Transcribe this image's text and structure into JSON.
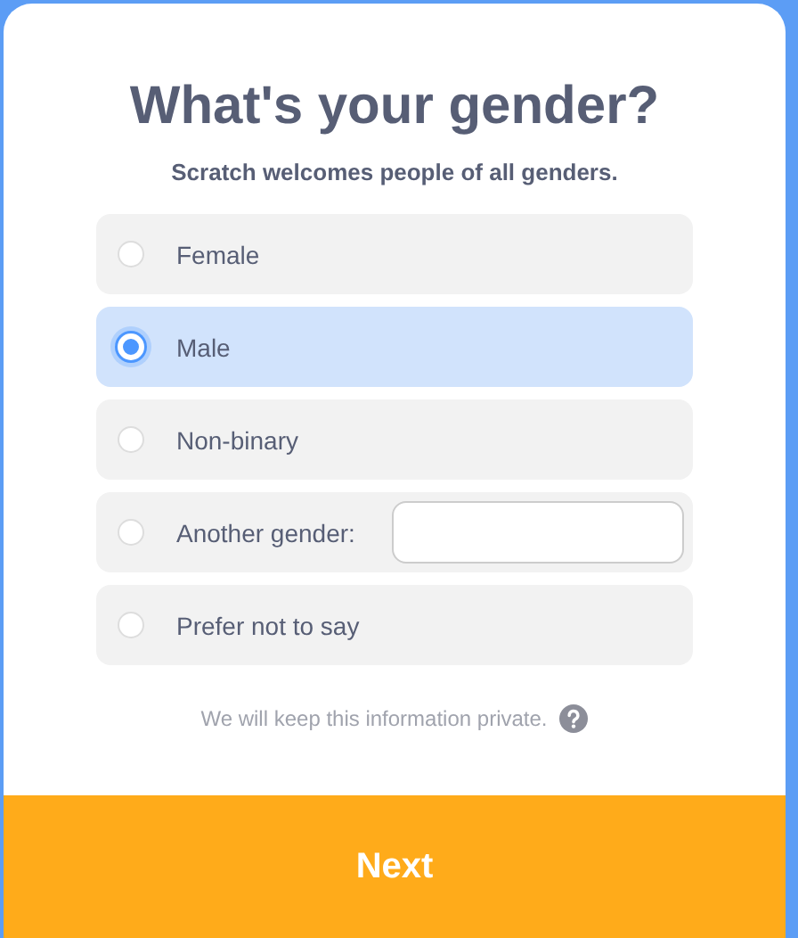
{
  "title": "What's your gender?",
  "subtitle": "Scratch welcomes people of all genders.",
  "options": [
    {
      "label": "Female",
      "selected": false,
      "kind": "plain"
    },
    {
      "label": "Male",
      "selected": true,
      "kind": "plain"
    },
    {
      "label": "Non-binary",
      "selected": false,
      "kind": "plain"
    },
    {
      "label": "Another gender:",
      "selected": false,
      "kind": "text-entry"
    },
    {
      "label": "Prefer not to say",
      "selected": false,
      "kind": "plain"
    }
  ],
  "privacy_note": "We will keep this information private.",
  "next_button": "Next"
}
